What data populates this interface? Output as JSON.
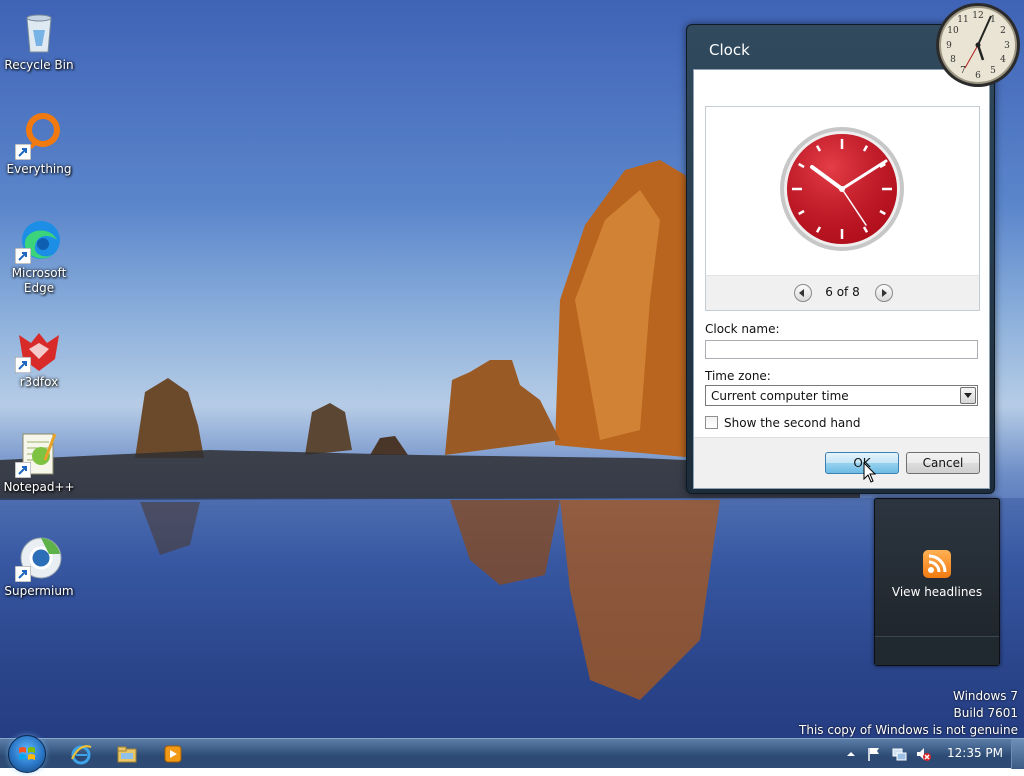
{
  "desktop": {
    "icons": [
      {
        "label": "Recycle Bin",
        "icon": "recycle-bin-icon"
      },
      {
        "label": "Everything",
        "icon": "everything-icon"
      },
      {
        "label": "Microsoft Edge",
        "icon": "edge-icon"
      },
      {
        "label": "r3dfox",
        "icon": "r3dfox-icon"
      },
      {
        "label": "Notepad++",
        "icon": "notepadpp-icon"
      },
      {
        "label": "Supermium",
        "icon": "supermium-icon"
      }
    ],
    "watermark": {
      "line1": "Windows 7",
      "line2": "Build 7601",
      "line3": "This copy of Windows is not genuine"
    }
  },
  "feed_gadget": {
    "label": "View headlines"
  },
  "dialog": {
    "title": "Clock",
    "page_indicator": "6 of 8",
    "clock_name_label": "Clock name:",
    "clock_name_value": "",
    "time_zone_label": "Time zone:",
    "time_zone_value": "Current computer time",
    "second_hand_label": "Show the second hand",
    "second_hand_checked": false,
    "ok_label": "OK",
    "cancel_label": "Cancel"
  },
  "taskbar": {
    "clock": "12:35 PM",
    "pinned": [
      "internet-explorer-icon",
      "explorer-icon",
      "media-player-icon"
    ],
    "tray": [
      "show-hidden-icons-icon",
      "action-center-icon",
      "network-icon",
      "volume-muted-icon"
    ]
  },
  "colors": {
    "accent_clock": "#c0121f",
    "taskbar": "#2c4a73",
    "ok_button": "#6ebbe4"
  }
}
